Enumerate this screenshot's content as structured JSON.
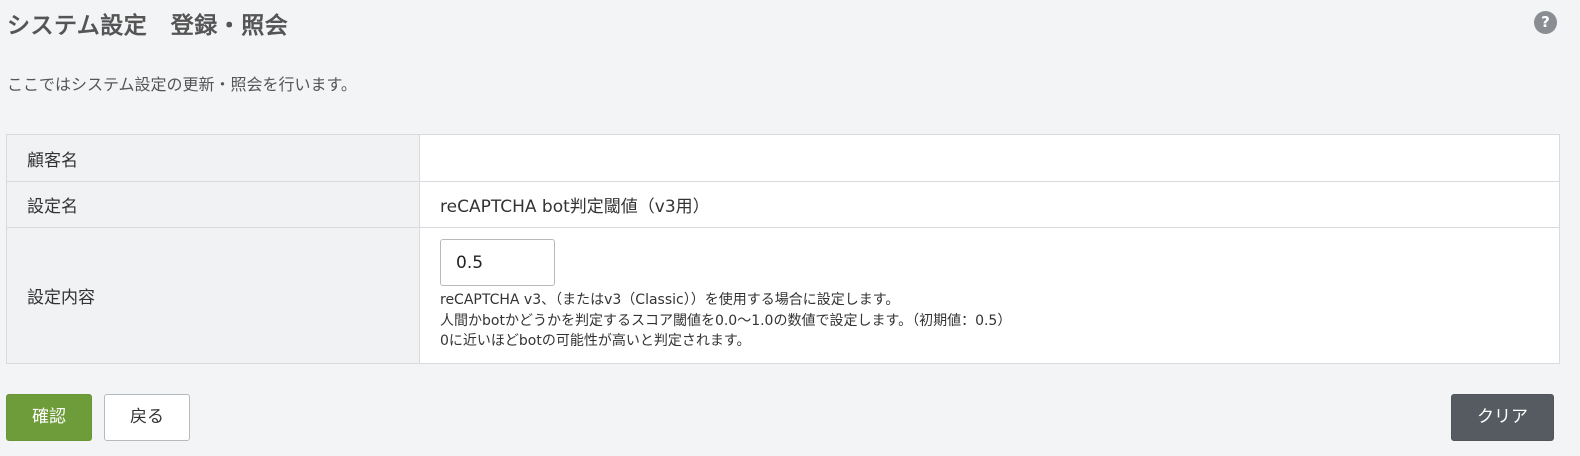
{
  "header": {
    "title": "システム設定　登録・照会",
    "help_icon_glyph": "?"
  },
  "description": "ここではシステム設定の更新・照会を行います。",
  "form": {
    "rows": [
      {
        "label": "顧客名",
        "value": ""
      },
      {
        "label": "設定名",
        "value": "reCAPTCHA bot判定閾値（v3用）"
      },
      {
        "label": "設定内容",
        "input_value": "0.5",
        "help": [
          "reCAPTCHA v3、（またはv3（Classic））を使用する場合に設定します。",
          "人間かbotかどうかを判定するスコア閾値を0.0～1.0の数値で設定します。（初期値：0.5）",
          "0に近いほどbotの可能性が高いと判定されます。"
        ]
      }
    ]
  },
  "actions": {
    "confirm_label": "確認",
    "back_label": "戻る",
    "clear_label": "クリア"
  },
  "colors": {
    "confirm_button": "#6f9c3a",
    "clear_button": "#565b61",
    "page_background": "#f3f4f6",
    "label_cell_background": "#f1f2f4"
  }
}
